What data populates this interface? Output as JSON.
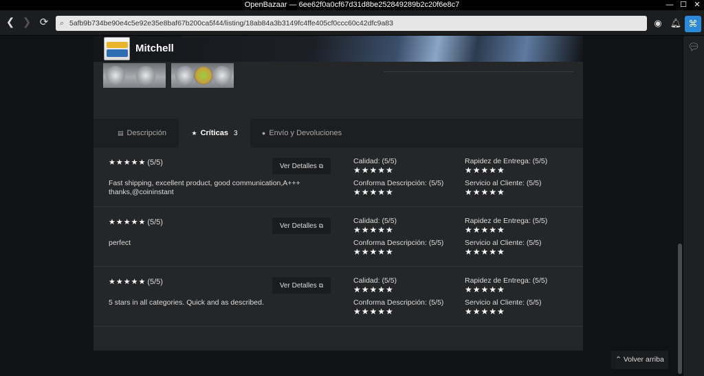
{
  "window": {
    "title": "OpenBazaar — 6ee62f0a0cf67d31d8be252849289b2c20f6e8c7",
    "controls": [
      "—",
      "☐",
      "✕"
    ]
  },
  "toolbar": {
    "address": "5afb9b734be90e4c5e92e35e8baf67b200ca5f44/listing/18ab84a3b3149fc4ffe405cf0ccc60c42dfc9a83"
  },
  "store": {
    "name": "Mitchell"
  },
  "tabs": [
    {
      "label": "Descripción",
      "icon": "▤"
    },
    {
      "label": "Críticas",
      "icon": "★",
      "count": "3"
    },
    {
      "label": "Envío y Devoluciones",
      "icon": "●"
    }
  ],
  "reviews_common": {
    "button_label": "Ver Detalles",
    "criteria": {
      "calidad": "Calidad: (5/5)",
      "rapidez": "Rapidez de Entrega: (5/5)",
      "conforma": "Conforma Descripción: (5/5)",
      "servicio": "Servicio al Cliente: (5/5)"
    },
    "stars": "★★★★★"
  },
  "reviews": [
    {
      "rating": "(5/5)",
      "text": "Fast shipping, excellent product, good communication,A+++ thanks,@coininstant"
    },
    {
      "rating": "(5/5)",
      "text": "perfect"
    },
    {
      "rating": "(5/5)",
      "text": "5 stars in all categories. Quick and as described."
    }
  ],
  "back_to_top": "Volver arriba"
}
